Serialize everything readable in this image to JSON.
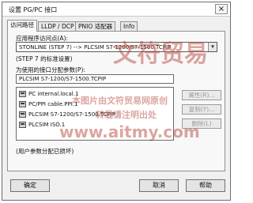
{
  "window": {
    "title": "设置 PG/PC 接口",
    "close_glyph": "×"
  },
  "tabs": [
    {
      "label": "访问路径",
      "active": true
    },
    {
      "label": "LLDP / DCP",
      "active": false
    },
    {
      "label": "PNIO 适配器",
      "active": false
    },
    {
      "label": "Info",
      "active": false
    }
  ],
  "access_point": {
    "label": "应用程序访问点(A):",
    "value": "STONLINE  (STEP 7)   --> PLCSIM S7-1200/S7-1500.TCPIP",
    "standard_note": "(STEP 7 的标准设置)"
  },
  "param": {
    "label": "为使用的接口分配参数(P):",
    "value": "PLCSIM S7-1200/S7-1500.TCPIP"
  },
  "interfaces": [
    {
      "label": "PC internal.local.1"
    },
    {
      "label": "PC/PPI cable.PPI.1"
    },
    {
      "label": "PLCSIM S7-1200/S7-1500.TCPIP"
    },
    {
      "label": "PLCSIM ISO.1"
    }
  ],
  "side_buttons": [
    {
      "label": "属性(R)..."
    },
    {
      "label": "复制(Y)..."
    },
    {
      "label": "删除(L)"
    }
  ],
  "user_param_text": "(用户参数分配已损坏)",
  "buttons": {
    "ok": "确定",
    "cancel": "取消",
    "help": "帮助"
  },
  "watermark": {
    "big": "文符贸易",
    "mid": "本图片由文符贸易网原创",
    "mid2": "转载请注明出处",
    "url": "www.aitmy.com",
    "color": "#b23a2e"
  }
}
